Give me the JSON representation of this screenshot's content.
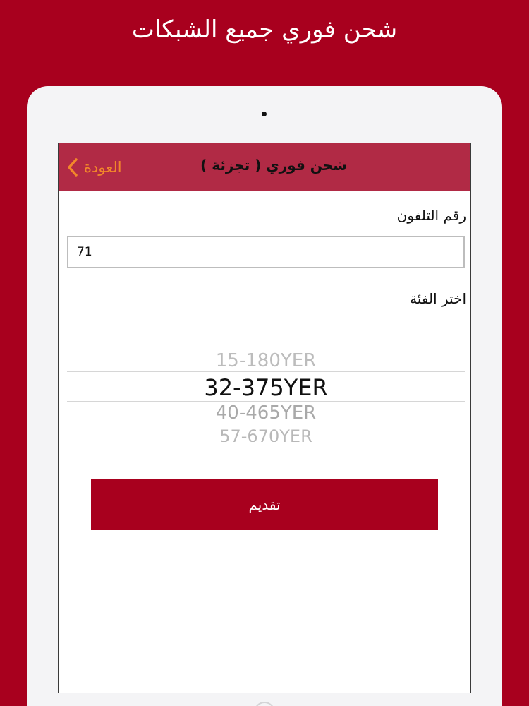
{
  "promo": {
    "title": "شحن فوري جميع الشبكات"
  },
  "navbar": {
    "back_label": "العودة",
    "title": "شحن فوري  (  تجزئة  )",
    "back_icon": "chevron-left-icon",
    "accent_color": "#f2872a",
    "bar_color": "#b12a45"
  },
  "form": {
    "phone_label": "رقم التلفون",
    "phone_value": "71",
    "category_label": "اختر الفئة",
    "categories": [
      "15-180YER",
      "32-375YER",
      "40-465YER",
      "57-670YER"
    ],
    "selected_category": "32-375YER",
    "submit_label": "تقديم"
  },
  "brand_color": "#a8001e"
}
